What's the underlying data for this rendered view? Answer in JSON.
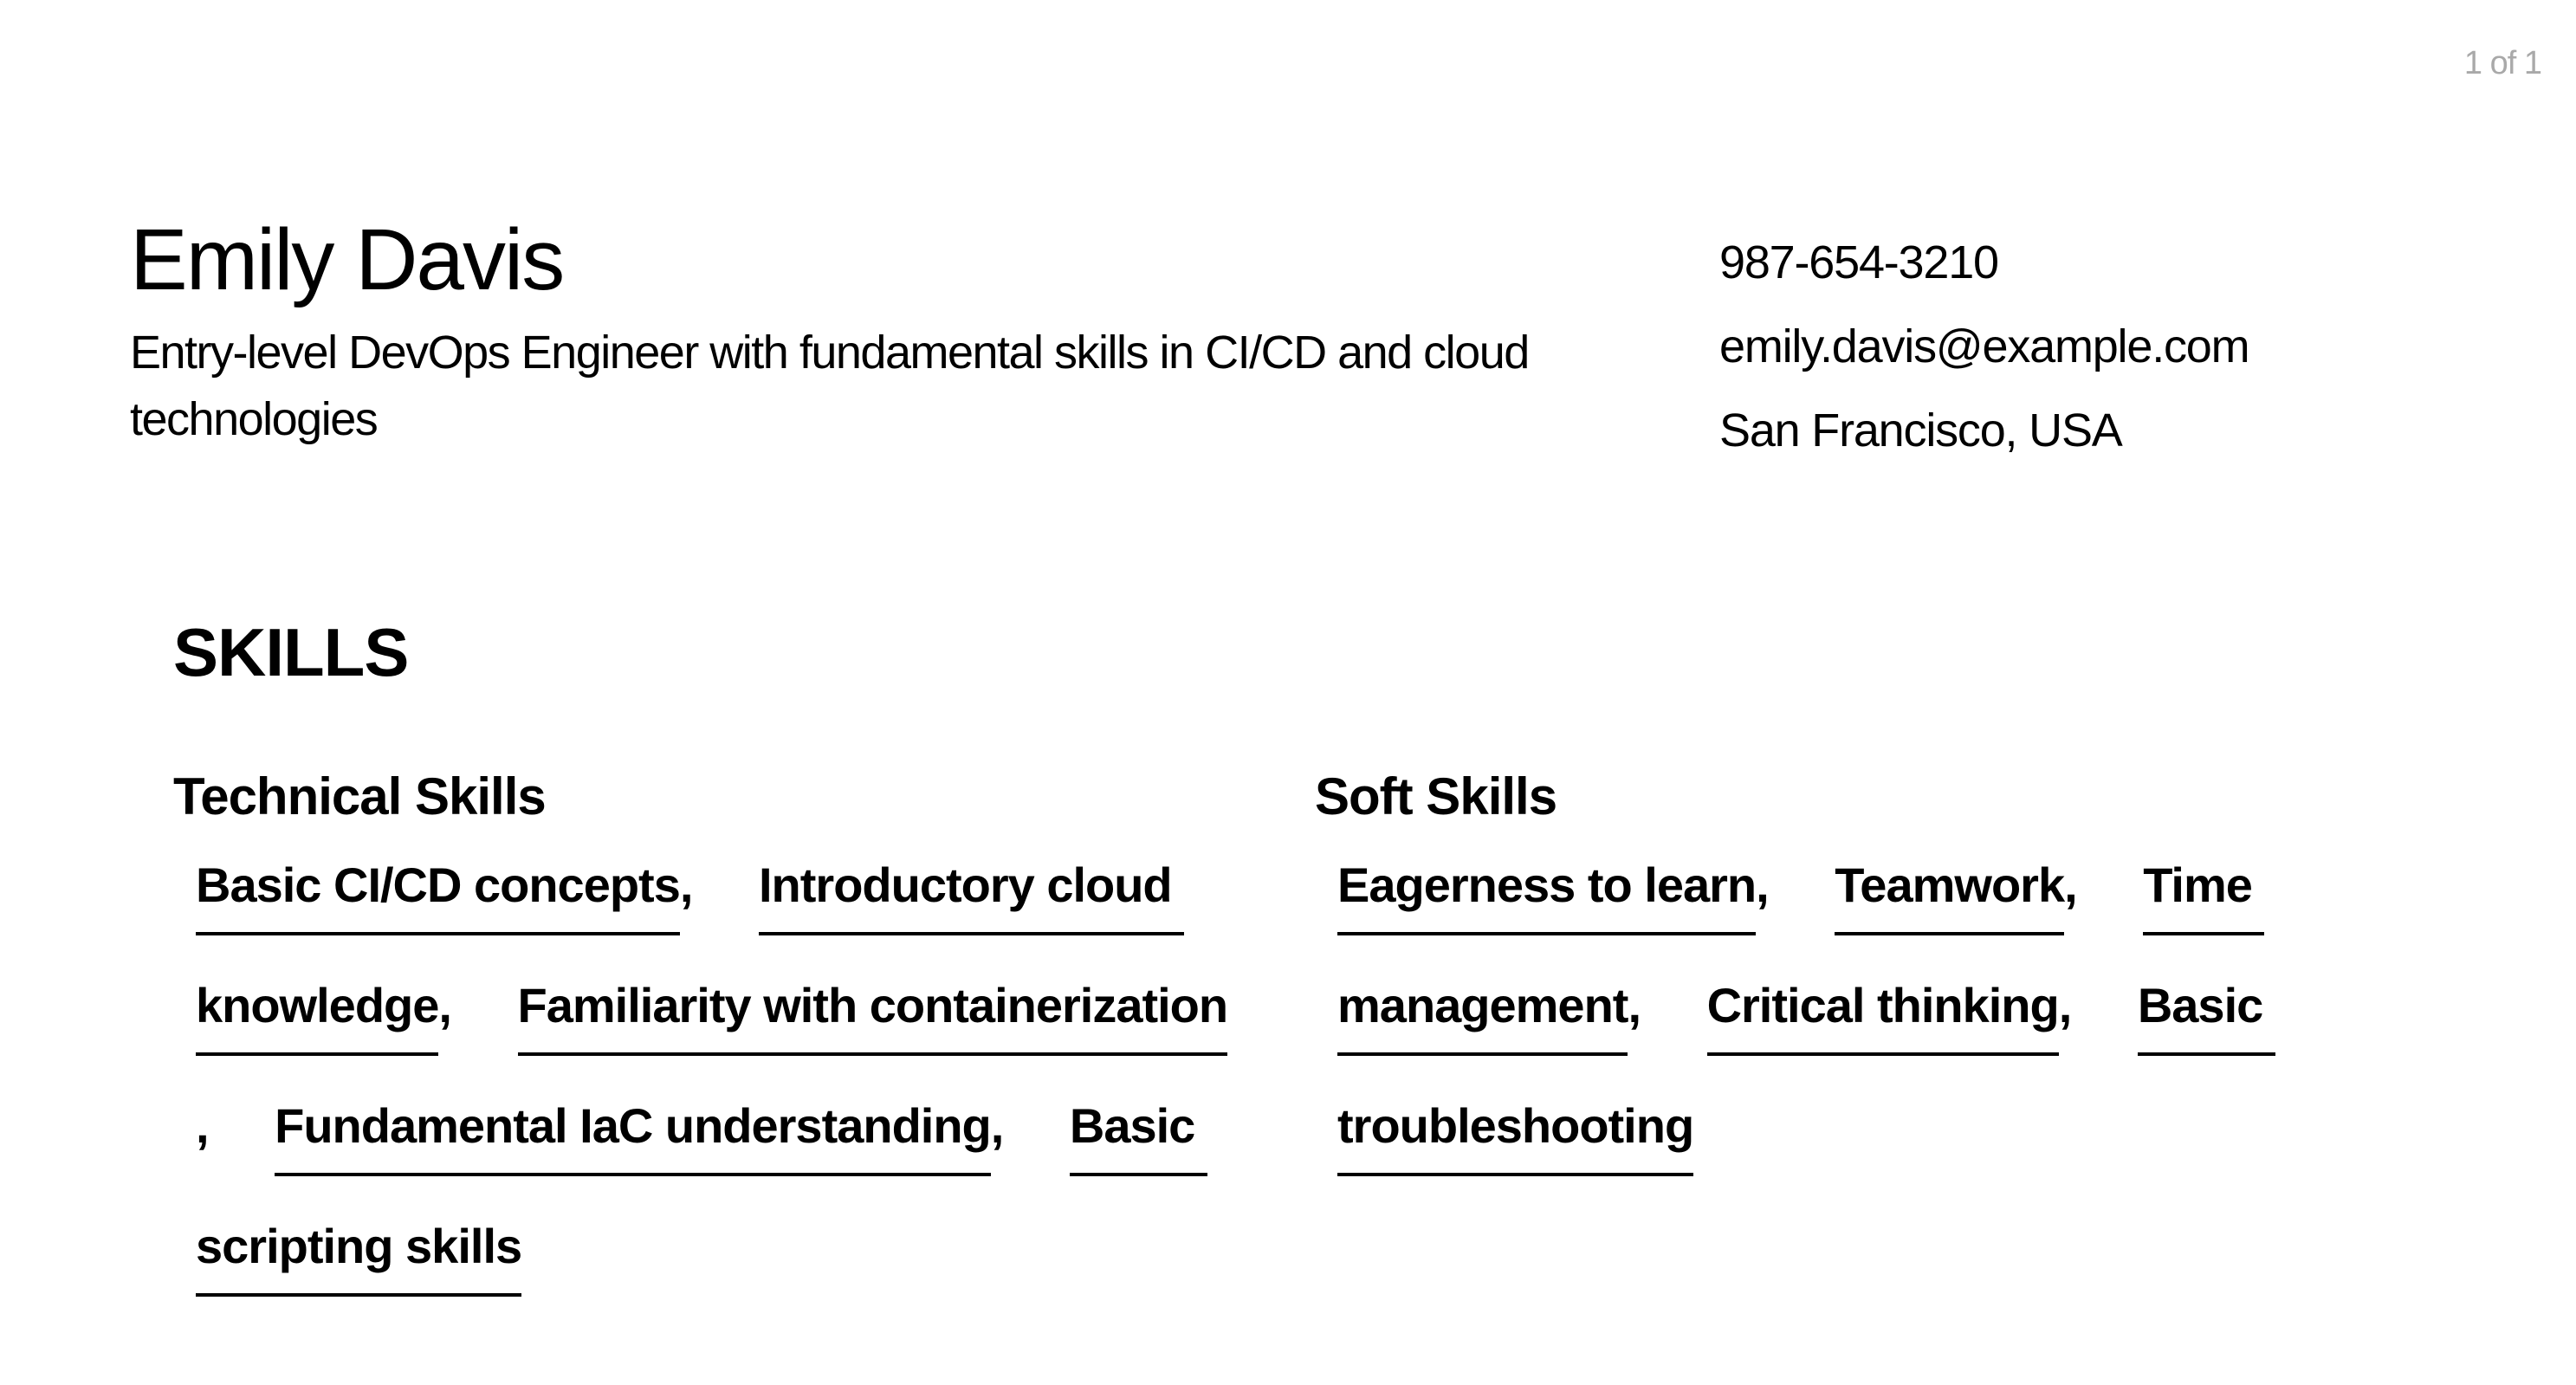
{
  "page_indicator": "1 of 1",
  "header": {
    "name": "Emily Davis",
    "summary": "Entry-level DevOps Engineer with fundamental skills in CI/CD and cloud technologies"
  },
  "contact": {
    "phone": "987-654-3210",
    "email": "emily.davis@example.com",
    "location": "San Francisco, USA"
  },
  "skills": {
    "title": "SKILLS",
    "separator": ",",
    "technical": {
      "title": "Technical Skills",
      "items": [
        "Basic CI/CD concepts",
        "Introductory cloud knowledge",
        "Familiarity with containerization",
        "Fundamental IaC understanding",
        "Basic scripting skills"
      ]
    },
    "soft": {
      "title": "Soft Skills",
      "items": [
        "Eagerness to learn",
        "Teamwork",
        "Time management",
        "Critical thinking",
        "Basic troubleshooting"
      ]
    }
  }
}
